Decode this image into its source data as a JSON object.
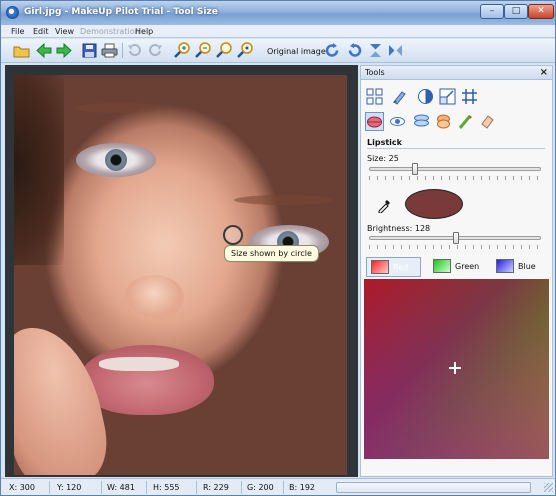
{
  "window": {
    "title": "Girl.jpg - MakeUp Pilot Trial - Tool Size",
    "min_glyph": "–",
    "max_glyph": "□",
    "close_glyph": "✕"
  },
  "menu": {
    "items": [
      "File",
      "Edit",
      "View",
      "Demonstration",
      "Help"
    ],
    "disabled_index": 3
  },
  "toolbar": {
    "original_image_label": "Original image",
    "icons": [
      "open-folder-icon",
      "back-arrow-icon",
      "forward-arrow-icon",
      "save-icon",
      "print-icon",
      "undo-icon",
      "redo-icon",
      "zoom-in-icon",
      "zoom-out-icon",
      "zoom-fit-icon",
      "zoom-actual-icon",
      "rotate-left-icon",
      "rotate-right-icon",
      "flip-vertical-icon",
      "flip-horizontal-icon"
    ]
  },
  "canvas": {
    "tooltip": "Size shown by circle"
  },
  "tools_panel": {
    "title": "Tools",
    "close_glyph": "×",
    "section": "Lipstick",
    "size_label": "Size: 25",
    "size_value": 25,
    "brightness_label": "Brightness: 128",
    "brightness_value": 128,
    "swatch_color": "#7a3a3a",
    "tabs": [
      {
        "label": "Red",
        "active": true
      },
      {
        "label": "Green",
        "active": false
      },
      {
        "label": "Blue",
        "active": false
      }
    ]
  },
  "status": {
    "x": "X: 300",
    "y": "Y: 120",
    "w": "W: 481",
    "h": "H: 555",
    "r": "R: 229",
    "g": "G: 200",
    "b": "B: 192"
  }
}
